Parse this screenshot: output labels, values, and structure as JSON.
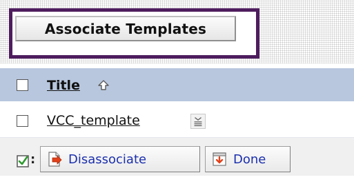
{
  "toolbar": {
    "associate_label": "Associate Templates"
  },
  "table": {
    "columns": [
      {
        "label": "Title",
        "sort": "ascending"
      }
    ],
    "rows": [
      {
        "title": "VCC_template"
      }
    ]
  },
  "footer": {
    "separator": ":",
    "disassociate_label": "Disassociate",
    "done_label": "Done"
  },
  "colors": {
    "highlight_border": "#4e1d5e",
    "header_row": "#b8c7de",
    "button_text": "#1b2fae"
  },
  "icons": {
    "sort": "sort-ascending-arrow-icon",
    "row_menu": "row-actions-menu-icon",
    "check_all": "check-all-icon",
    "disassociate": "disassociate-icon",
    "done": "done-icon"
  }
}
